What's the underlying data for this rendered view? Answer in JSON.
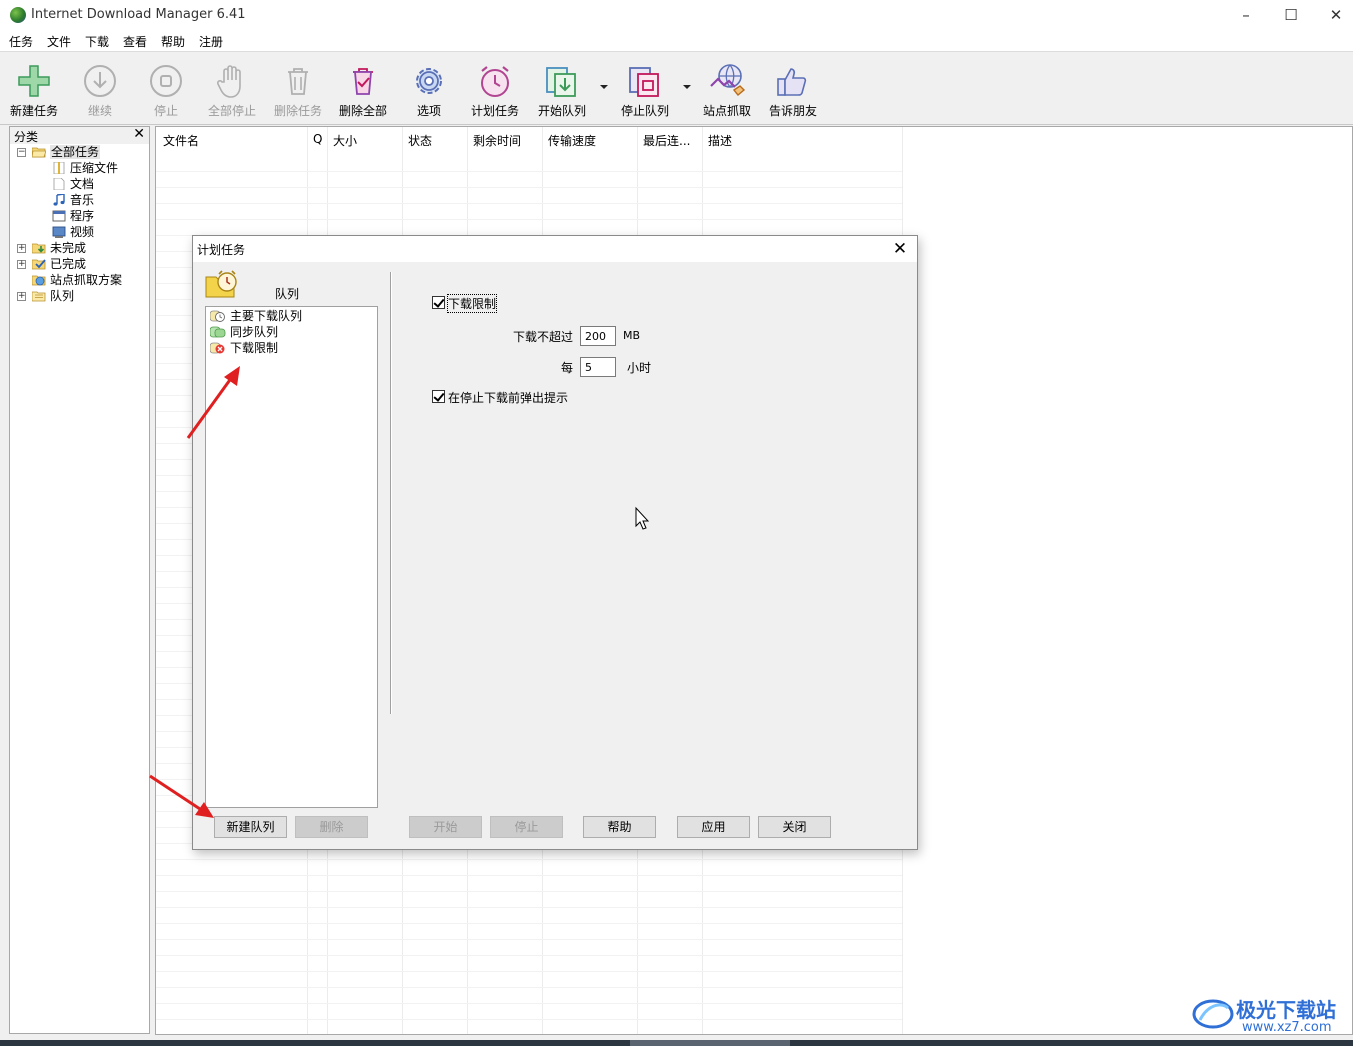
{
  "window": {
    "title": "Internet Download Manager 6.41"
  },
  "menu": [
    "任务",
    "文件",
    "下载",
    "查看",
    "帮助",
    "注册"
  ],
  "toolbar": {
    "new_task": "新建任务",
    "resume": "继续",
    "stop": "停止",
    "stop_all": "全部停止",
    "delete_task": "删除任务",
    "delete_all": "删除全部",
    "options": "选项",
    "scheduler": "计划任务",
    "start_queue": "开始队列",
    "stop_queue": "停止队列",
    "site_grabber": "站点抓取",
    "tell_friend": "告诉朋友"
  },
  "categories": {
    "header": "分类",
    "all": "全部任务",
    "compressed": "压缩文件",
    "documents": "文档",
    "music": "音乐",
    "programs": "程序",
    "video": "视频",
    "unfinished": "未完成",
    "finished": "已完成",
    "grabber_projects": "站点抓取方案",
    "queues": "队列"
  },
  "columns": {
    "filename": "文件名",
    "q": "Q",
    "size": "大小",
    "status": "状态",
    "time_left": "剩余时间",
    "speed": "传输速度",
    "last_try": "最后连...",
    "description": "描述"
  },
  "dialog": {
    "title": "计划任务",
    "queue_label": "队列",
    "queues": [
      "主要下载队列",
      "同步队列",
      "下载限制"
    ],
    "limit_checkbox": "下载限制",
    "no_more_than": "下载不超过",
    "mb_value": "200",
    "mb_unit": "MB",
    "every": "每",
    "hours_value": "5",
    "hours_unit": "小时",
    "popup_checkbox": "在停止下载前弹出提示",
    "buttons": {
      "new_queue": "新建队列",
      "delete": "删除",
      "start": "开始",
      "stop": "停止",
      "help": "帮助",
      "apply": "应用",
      "close": "关闭"
    }
  },
  "watermark": {
    "name": "极光下载站",
    "url": "www.xz7.com"
  }
}
